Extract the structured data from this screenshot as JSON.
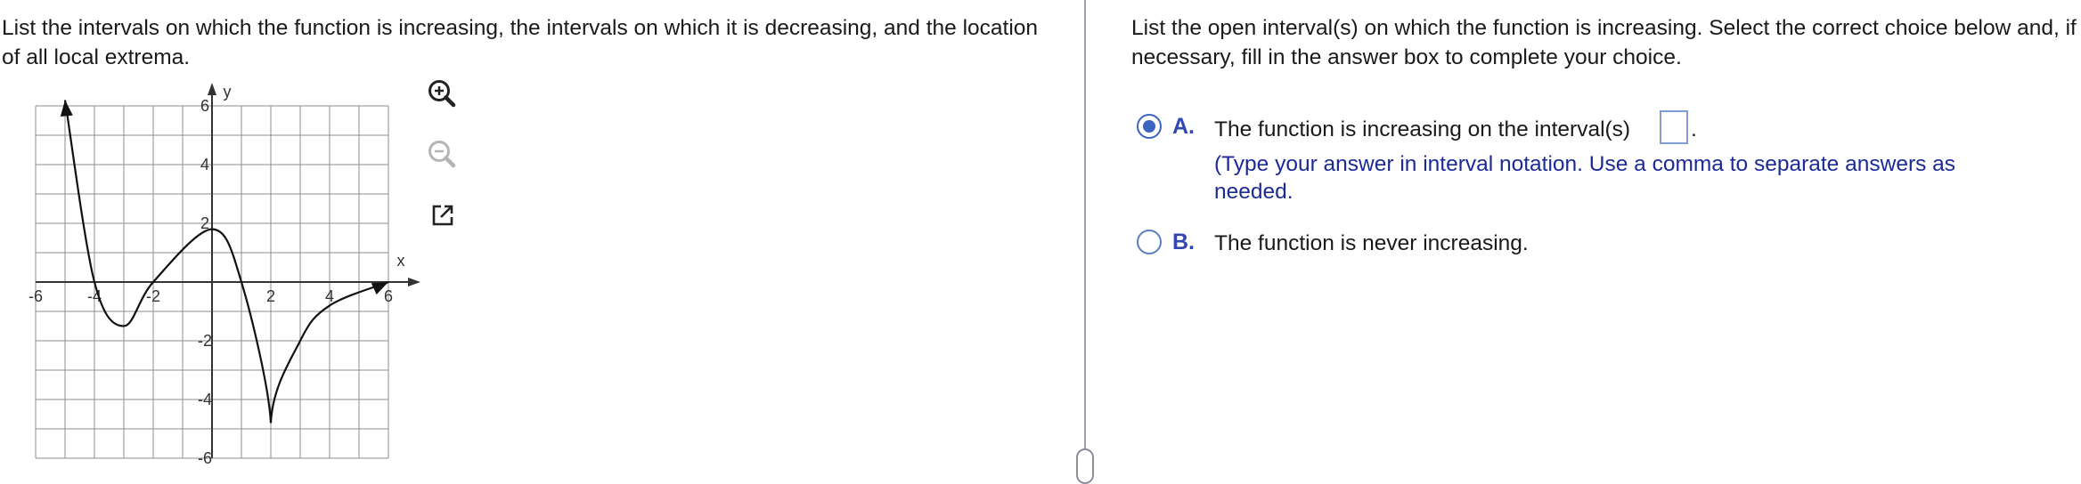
{
  "left": {
    "question": "List the intervals on which the function is increasing, the intervals on which it is decreasing, and the location of all local extrema."
  },
  "graph": {
    "x_axis_label": "x",
    "y_axis_label": "y",
    "x_tick_labels": [
      "-6",
      "-4",
      "-2",
      "2",
      "4",
      "6"
    ],
    "y_tick_labels": [
      "6",
      "4",
      "2",
      "-2",
      "-4",
      "-6"
    ],
    "x_range": [
      -6,
      6
    ],
    "y_range": [
      -6,
      6
    ],
    "grid": true,
    "curve_points": [
      [
        -5,
        6.2
      ],
      [
        -4,
        0
      ],
      [
        -3,
        -1.5
      ],
      [
        -2,
        0
      ],
      [
        0,
        1.8
      ],
      [
        1,
        0
      ],
      [
        2,
        -4.8
      ],
      [
        3,
        -2
      ],
      [
        4,
        -0.8
      ],
      [
        6,
        0
      ]
    ],
    "curve_color": "#111111",
    "grid_color": "#8c8c8c"
  },
  "tools": {
    "zoom_in_icon": "zoom-in-icon",
    "zoom_out_icon": "zoom-out-icon",
    "popout_icon": "external-link-icon"
  },
  "right": {
    "prompt": "List the open interval(s) on which the function is increasing. Select the correct choice below and, if necessary, fill in the answer box to complete your choice.",
    "choices": [
      {
        "letter": "A.",
        "text": "The function is increasing on the interval(s)",
        "after_box": ".",
        "hint": "(Type your answer in interval notation. Use a comma to separate answers as needed.",
        "selected": true,
        "answer_value": ""
      },
      {
        "letter": "B.",
        "text": "The function is never increasing.",
        "selected": false
      }
    ],
    "accent_color": "#3d64c0"
  }
}
